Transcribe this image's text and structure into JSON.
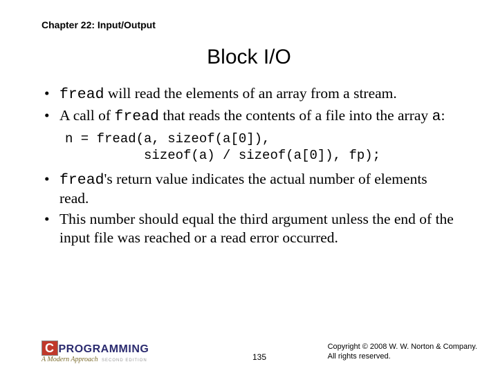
{
  "chapter": "Chapter 22: Input/Output",
  "title": "Block I/O",
  "bullets": {
    "b1": {
      "code1": "fread",
      "t1": " will read the elements of an array from a stream."
    },
    "b2": {
      "t1": "A call of ",
      "code1": "fread",
      "t2": " that reads the contents of a file into the array ",
      "code2": "a",
      "t3": ":"
    },
    "b3": {
      "code1": "fread",
      "t1": "'s return value indicates the actual number of elements read."
    },
    "b4": {
      "t1": "This number should equal the third argument unless the end of the input file was reached or a read error occurred."
    }
  },
  "code_block": "n = fread(a, sizeof(a[0]),\n          sizeof(a) / sizeof(a[0]), fp);",
  "footer": {
    "logo_c": "C",
    "logo_rest": "PROGRAMMING",
    "logo_sub": "A Modern Approach",
    "logo_edition": "SECOND EDITION",
    "page": "135",
    "copyright_l1": "Copyright © 2008 W. W. Norton & Company.",
    "copyright_l2": "All rights reserved."
  }
}
